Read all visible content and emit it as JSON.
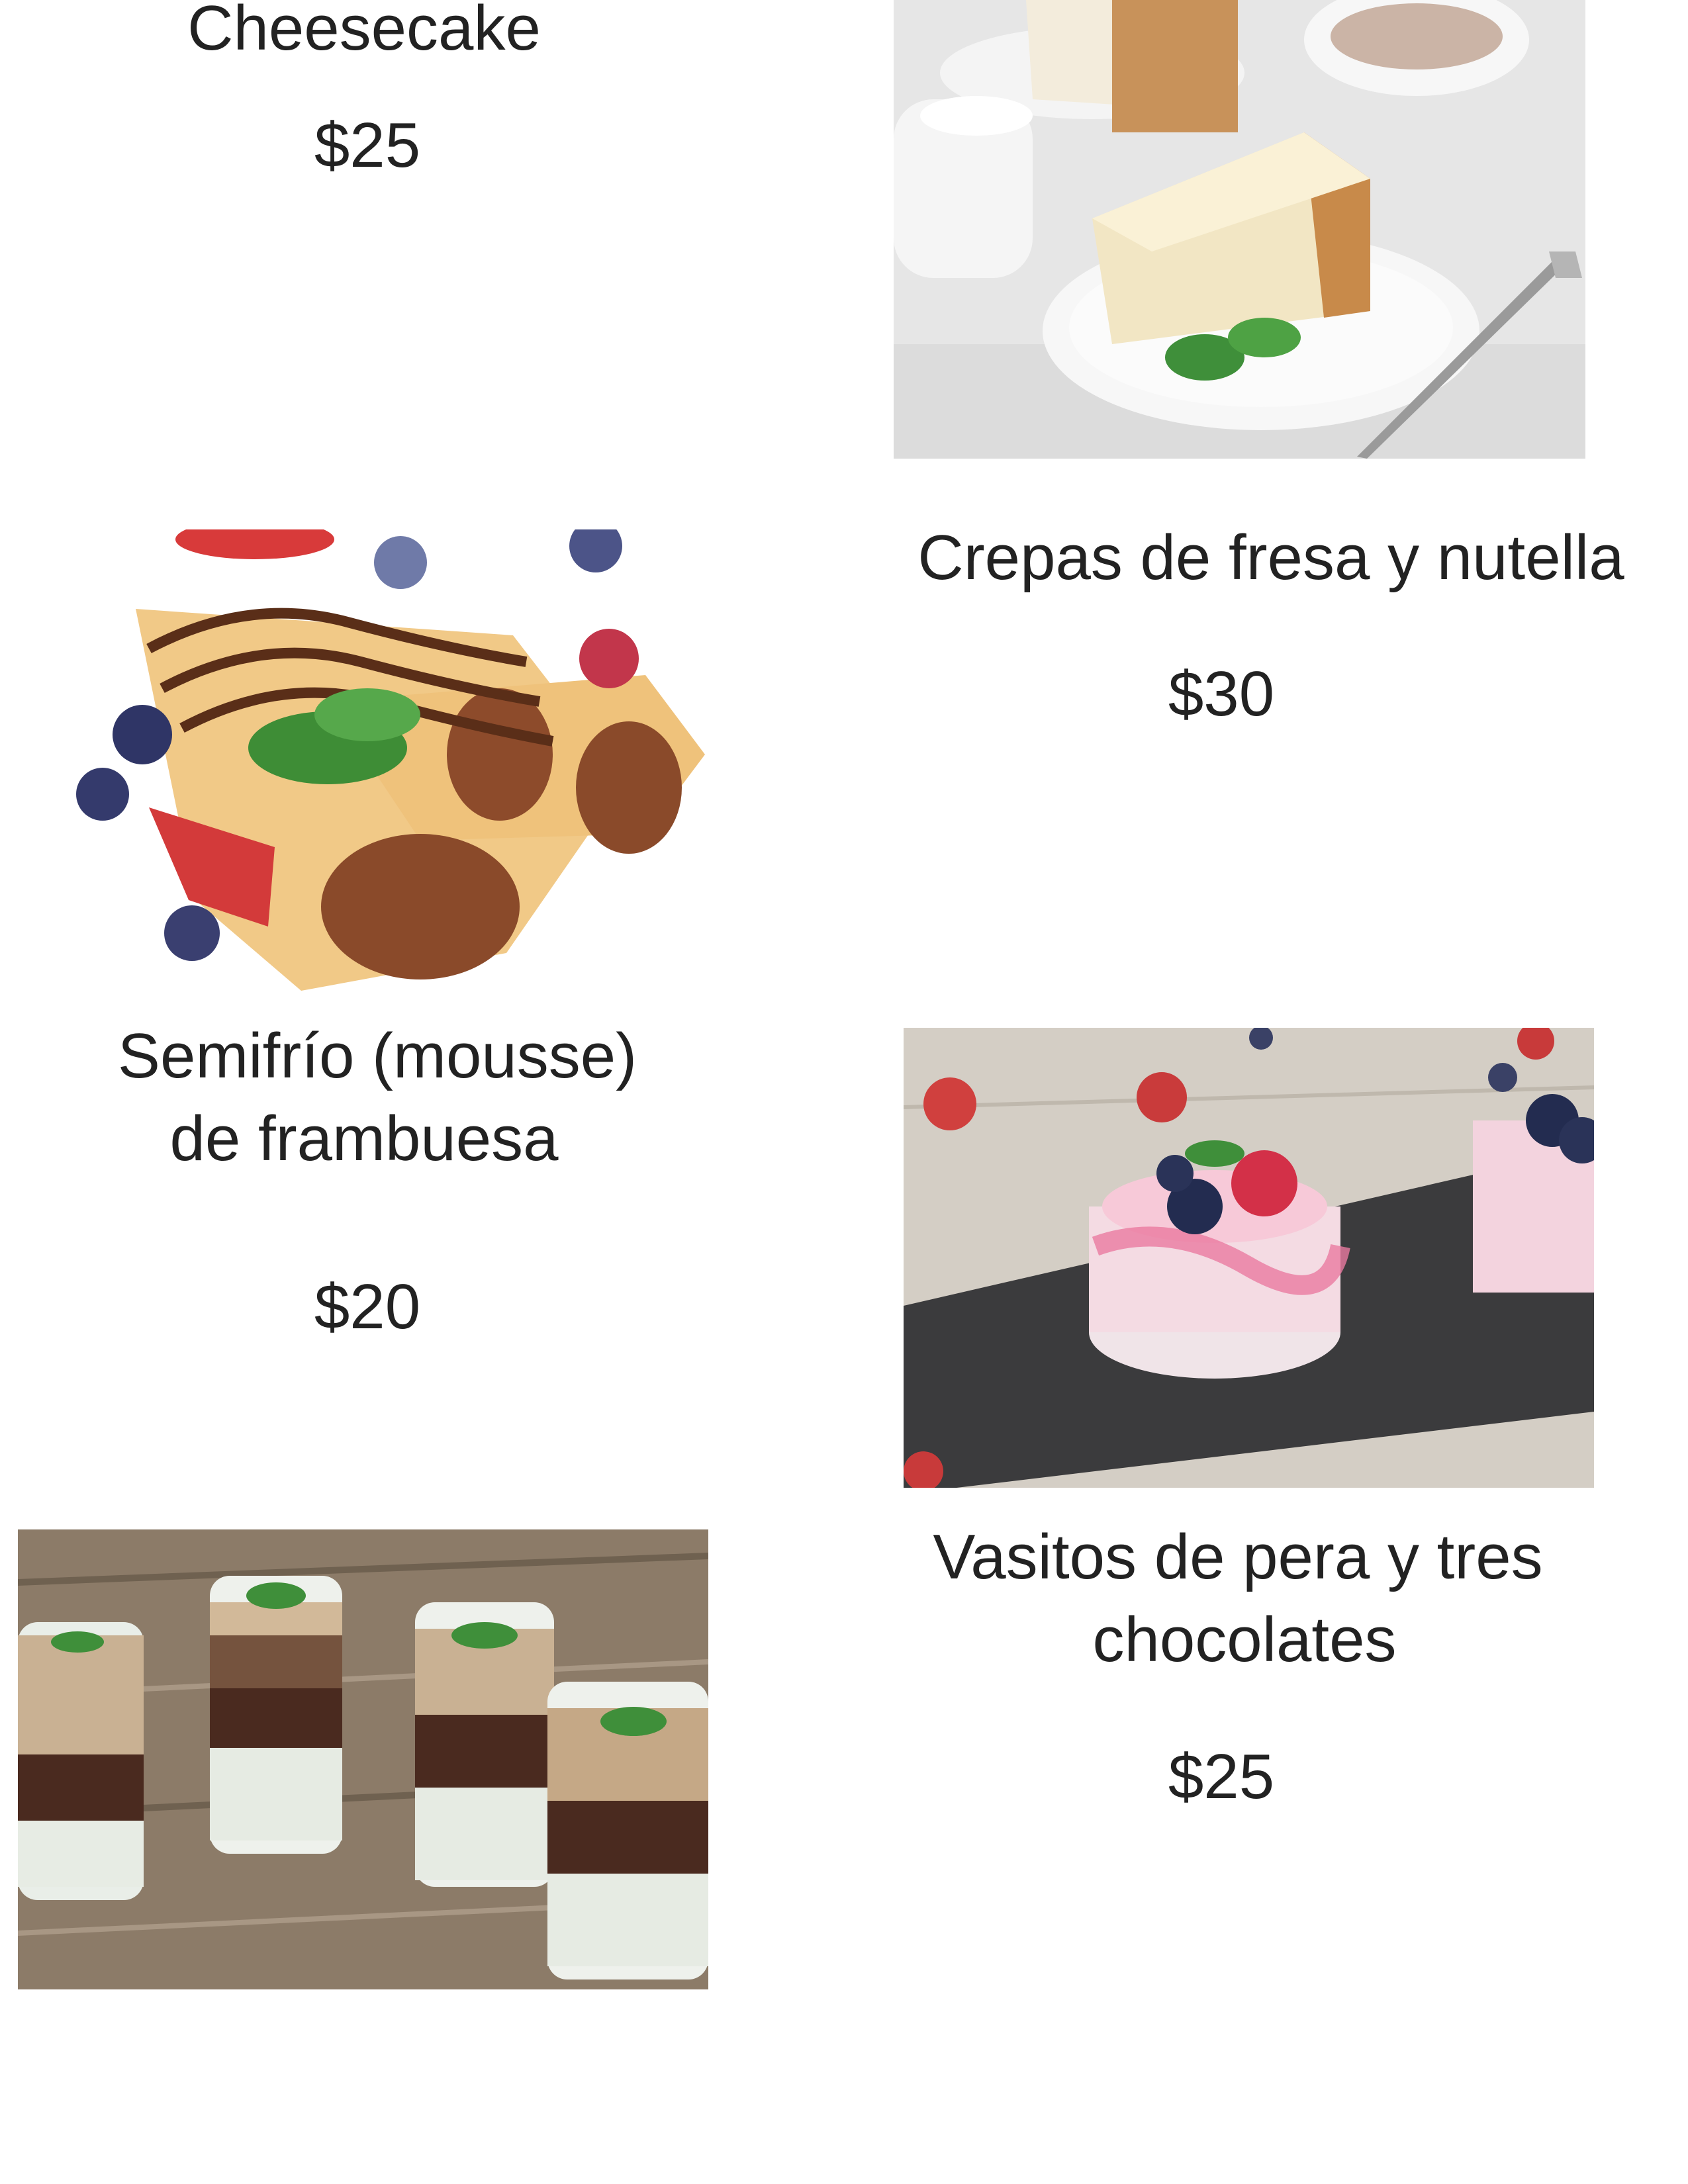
{
  "menu": {
    "items": [
      {
        "name": "Cheesecake",
        "price": "$25",
        "photo": "cheesecake-photo"
      },
      {
        "name": "Crepas de fresa y nutella",
        "price": "$30",
        "photo": "crepes-photo"
      },
      {
        "name_line1": "Semifrío (mousse)",
        "name_line2": "de frambuesa",
        "price": "$20",
        "photo": "mousse-photo"
      },
      {
        "name_line1": "Vasitos de pera y tres",
        "name_line2": "chocolates",
        "price": "$25",
        "photo": "verrines-photo"
      }
    ]
  }
}
